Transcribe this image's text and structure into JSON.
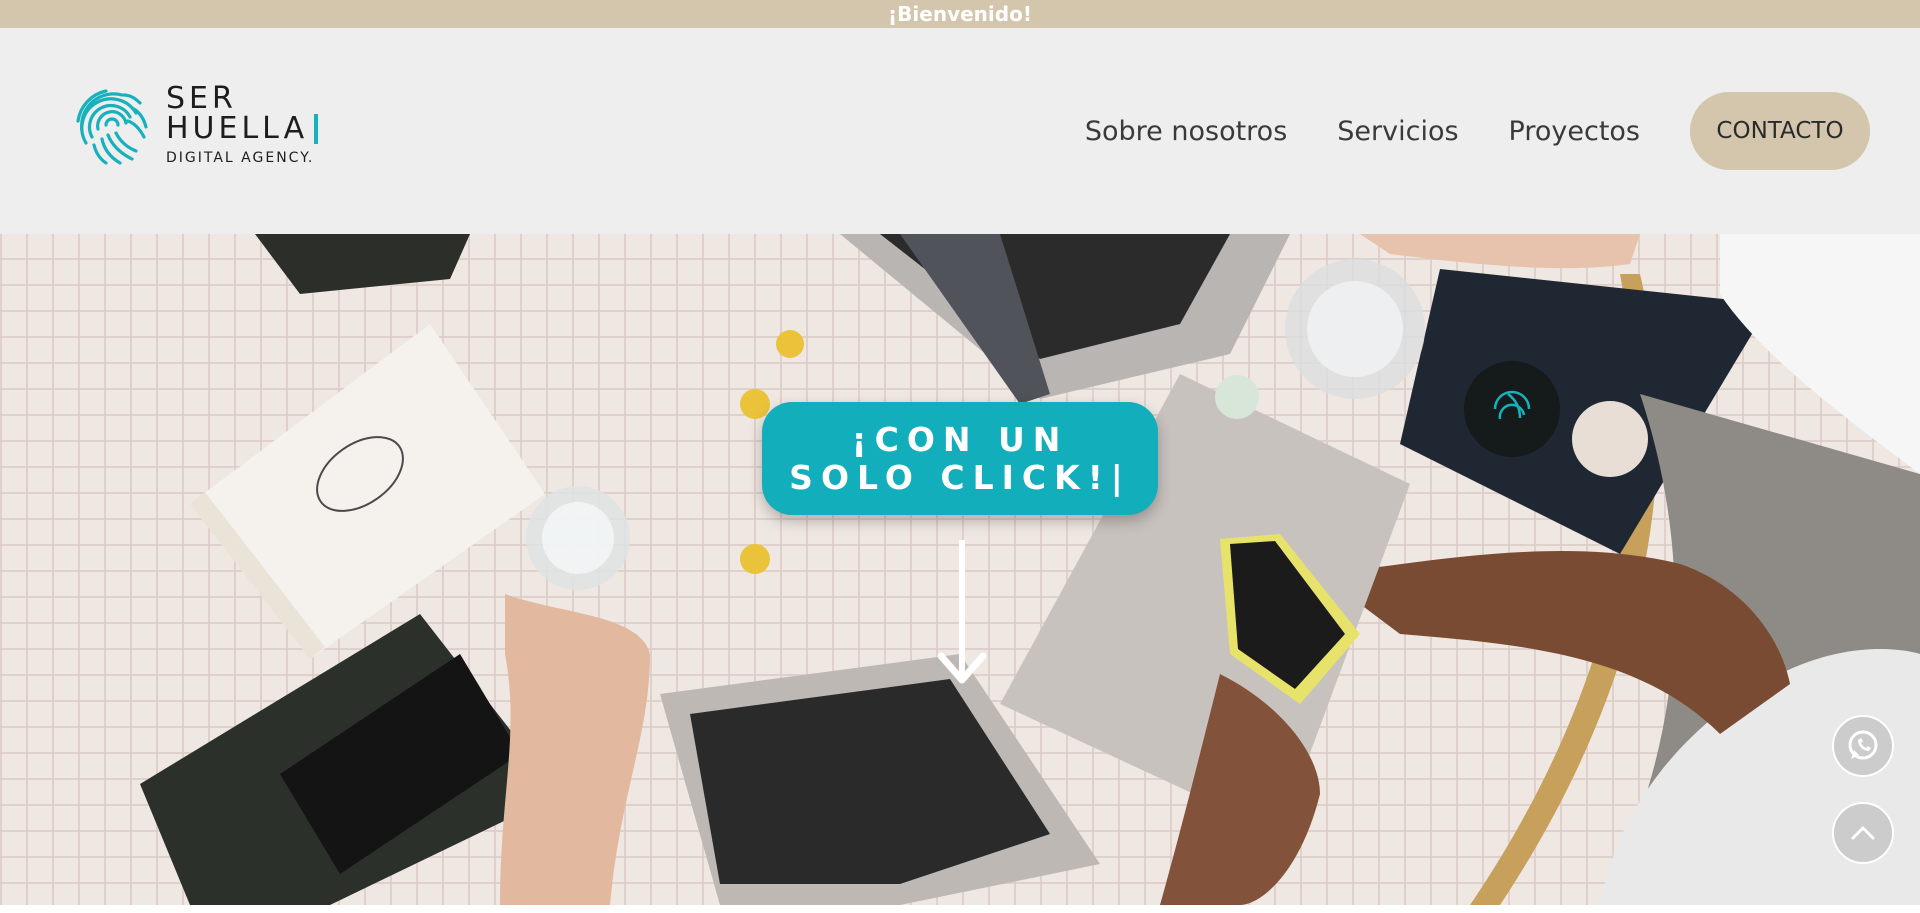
{
  "topbar": {
    "text": "¡Bienvenido!"
  },
  "logo": {
    "line1": "SER",
    "line2": "HUELLA",
    "line3": "DIGITAL AGENCY.",
    "icon": "fingerprint-logo-icon",
    "accent_color": "#16b1bd"
  },
  "nav": {
    "items": [
      {
        "label": "Sobre nosotros"
      },
      {
        "label": "Servicios"
      },
      {
        "label": "Proyectos"
      }
    ],
    "contact_label": "CONTACTO"
  },
  "hero": {
    "cta_label": "¡CON UN SOLO CLICK!|",
    "arrow_icon": "arrow-down-icon",
    "background": "workspace-table-photo"
  },
  "floating": {
    "whatsapp_icon": "whatsapp-icon",
    "scroll_top_icon": "chevron-up-icon"
  },
  "colors": {
    "topbar": "#d4c6ad",
    "header": "#eeeeee",
    "cta": "#12aebb",
    "contact_button": "#d4c6ad"
  }
}
